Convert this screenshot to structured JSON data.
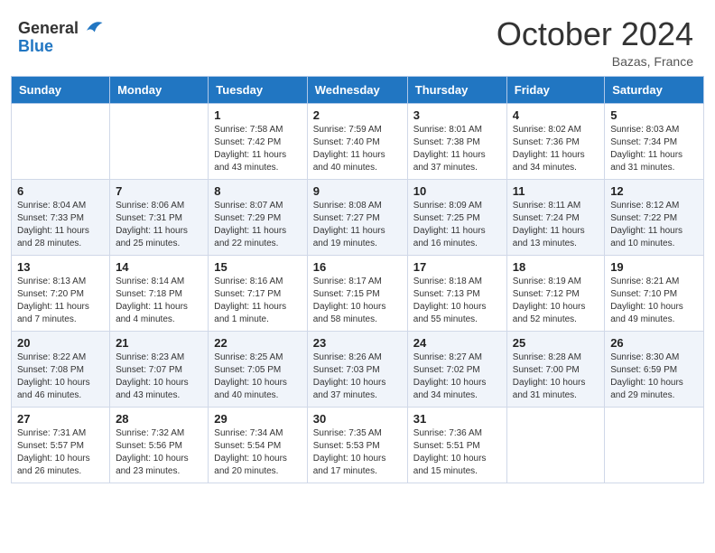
{
  "header": {
    "logo_general": "General",
    "logo_blue": "Blue",
    "month": "October 2024",
    "location": "Bazas, France"
  },
  "weekdays": [
    "Sunday",
    "Monday",
    "Tuesday",
    "Wednesday",
    "Thursday",
    "Friday",
    "Saturday"
  ],
  "weeks": [
    [
      {
        "day": "",
        "sunrise": "",
        "sunset": "",
        "daylight": ""
      },
      {
        "day": "",
        "sunrise": "",
        "sunset": "",
        "daylight": ""
      },
      {
        "day": "1",
        "sunrise": "Sunrise: 7:58 AM",
        "sunset": "Sunset: 7:42 PM",
        "daylight": "Daylight: 11 hours and 43 minutes."
      },
      {
        "day": "2",
        "sunrise": "Sunrise: 7:59 AM",
        "sunset": "Sunset: 7:40 PM",
        "daylight": "Daylight: 11 hours and 40 minutes."
      },
      {
        "day": "3",
        "sunrise": "Sunrise: 8:01 AM",
        "sunset": "Sunset: 7:38 PM",
        "daylight": "Daylight: 11 hours and 37 minutes."
      },
      {
        "day": "4",
        "sunrise": "Sunrise: 8:02 AM",
        "sunset": "Sunset: 7:36 PM",
        "daylight": "Daylight: 11 hours and 34 minutes."
      },
      {
        "day": "5",
        "sunrise": "Sunrise: 8:03 AM",
        "sunset": "Sunset: 7:34 PM",
        "daylight": "Daylight: 11 hours and 31 minutes."
      }
    ],
    [
      {
        "day": "6",
        "sunrise": "Sunrise: 8:04 AM",
        "sunset": "Sunset: 7:33 PM",
        "daylight": "Daylight: 11 hours and 28 minutes."
      },
      {
        "day": "7",
        "sunrise": "Sunrise: 8:06 AM",
        "sunset": "Sunset: 7:31 PM",
        "daylight": "Daylight: 11 hours and 25 minutes."
      },
      {
        "day": "8",
        "sunrise": "Sunrise: 8:07 AM",
        "sunset": "Sunset: 7:29 PM",
        "daylight": "Daylight: 11 hours and 22 minutes."
      },
      {
        "day": "9",
        "sunrise": "Sunrise: 8:08 AM",
        "sunset": "Sunset: 7:27 PM",
        "daylight": "Daylight: 11 hours and 19 minutes."
      },
      {
        "day": "10",
        "sunrise": "Sunrise: 8:09 AM",
        "sunset": "Sunset: 7:25 PM",
        "daylight": "Daylight: 11 hours and 16 minutes."
      },
      {
        "day": "11",
        "sunrise": "Sunrise: 8:11 AM",
        "sunset": "Sunset: 7:24 PM",
        "daylight": "Daylight: 11 hours and 13 minutes."
      },
      {
        "day": "12",
        "sunrise": "Sunrise: 8:12 AM",
        "sunset": "Sunset: 7:22 PM",
        "daylight": "Daylight: 11 hours and 10 minutes."
      }
    ],
    [
      {
        "day": "13",
        "sunrise": "Sunrise: 8:13 AM",
        "sunset": "Sunset: 7:20 PM",
        "daylight": "Daylight: 11 hours and 7 minutes."
      },
      {
        "day": "14",
        "sunrise": "Sunrise: 8:14 AM",
        "sunset": "Sunset: 7:18 PM",
        "daylight": "Daylight: 11 hours and 4 minutes."
      },
      {
        "day": "15",
        "sunrise": "Sunrise: 8:16 AM",
        "sunset": "Sunset: 7:17 PM",
        "daylight": "Daylight: 11 hours and 1 minute."
      },
      {
        "day": "16",
        "sunrise": "Sunrise: 8:17 AM",
        "sunset": "Sunset: 7:15 PM",
        "daylight": "Daylight: 10 hours and 58 minutes."
      },
      {
        "day": "17",
        "sunrise": "Sunrise: 8:18 AM",
        "sunset": "Sunset: 7:13 PM",
        "daylight": "Daylight: 10 hours and 55 minutes."
      },
      {
        "day": "18",
        "sunrise": "Sunrise: 8:19 AM",
        "sunset": "Sunset: 7:12 PM",
        "daylight": "Daylight: 10 hours and 52 minutes."
      },
      {
        "day": "19",
        "sunrise": "Sunrise: 8:21 AM",
        "sunset": "Sunset: 7:10 PM",
        "daylight": "Daylight: 10 hours and 49 minutes."
      }
    ],
    [
      {
        "day": "20",
        "sunrise": "Sunrise: 8:22 AM",
        "sunset": "Sunset: 7:08 PM",
        "daylight": "Daylight: 10 hours and 46 minutes."
      },
      {
        "day": "21",
        "sunrise": "Sunrise: 8:23 AM",
        "sunset": "Sunset: 7:07 PM",
        "daylight": "Daylight: 10 hours and 43 minutes."
      },
      {
        "day": "22",
        "sunrise": "Sunrise: 8:25 AM",
        "sunset": "Sunset: 7:05 PM",
        "daylight": "Daylight: 10 hours and 40 minutes."
      },
      {
        "day": "23",
        "sunrise": "Sunrise: 8:26 AM",
        "sunset": "Sunset: 7:03 PM",
        "daylight": "Daylight: 10 hours and 37 minutes."
      },
      {
        "day": "24",
        "sunrise": "Sunrise: 8:27 AM",
        "sunset": "Sunset: 7:02 PM",
        "daylight": "Daylight: 10 hours and 34 minutes."
      },
      {
        "day": "25",
        "sunrise": "Sunrise: 8:28 AM",
        "sunset": "Sunset: 7:00 PM",
        "daylight": "Daylight: 10 hours and 31 minutes."
      },
      {
        "day": "26",
        "sunrise": "Sunrise: 8:30 AM",
        "sunset": "Sunset: 6:59 PM",
        "daylight": "Daylight: 10 hours and 29 minutes."
      }
    ],
    [
      {
        "day": "27",
        "sunrise": "Sunrise: 7:31 AM",
        "sunset": "Sunset: 5:57 PM",
        "daylight": "Daylight: 10 hours and 26 minutes."
      },
      {
        "day": "28",
        "sunrise": "Sunrise: 7:32 AM",
        "sunset": "Sunset: 5:56 PM",
        "daylight": "Daylight: 10 hours and 23 minutes."
      },
      {
        "day": "29",
        "sunrise": "Sunrise: 7:34 AM",
        "sunset": "Sunset: 5:54 PM",
        "daylight": "Daylight: 10 hours and 20 minutes."
      },
      {
        "day": "30",
        "sunrise": "Sunrise: 7:35 AM",
        "sunset": "Sunset: 5:53 PM",
        "daylight": "Daylight: 10 hours and 17 minutes."
      },
      {
        "day": "31",
        "sunrise": "Sunrise: 7:36 AM",
        "sunset": "Sunset: 5:51 PM",
        "daylight": "Daylight: 10 hours and 15 minutes."
      },
      {
        "day": "",
        "sunrise": "",
        "sunset": "",
        "daylight": ""
      },
      {
        "day": "",
        "sunrise": "",
        "sunset": "",
        "daylight": ""
      }
    ]
  ]
}
